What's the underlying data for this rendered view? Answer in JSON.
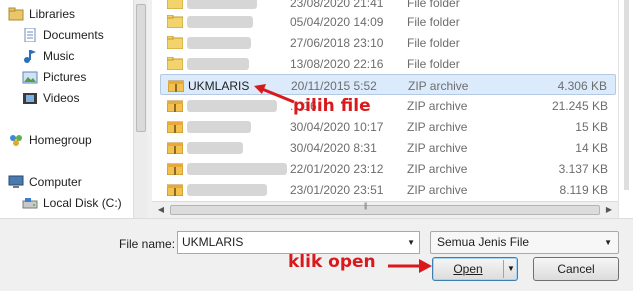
{
  "nav": {
    "items": [
      {
        "label": "Libraries",
        "icon": "libraries-icon"
      },
      {
        "label": "Documents",
        "icon": "documents-icon"
      },
      {
        "label": "Music",
        "icon": "music-icon"
      },
      {
        "label": "Pictures",
        "icon": "pictures-icon"
      },
      {
        "label": "Videos",
        "icon": "videos-icon"
      },
      {
        "label": "Homegroup",
        "icon": "homegroup-icon"
      },
      {
        "label": "Computer",
        "icon": "computer-icon"
      },
      {
        "label": "Local Disk (C:)",
        "icon": "local-disk-icon"
      }
    ]
  },
  "files": [
    {
      "name": "",
      "date": "23/08/2020 21:41",
      "type": "File folder",
      "size": "",
      "kind": "folder"
    },
    {
      "name": "",
      "date": "05/04/2020 14:09",
      "type": "File folder",
      "size": "",
      "kind": "folder"
    },
    {
      "name": "",
      "date": "27/06/2018 23:10",
      "type": "File folder",
      "size": "",
      "kind": "folder"
    },
    {
      "name": "",
      "date": "13/08/2020 22:16",
      "type": "File folder",
      "size": "",
      "kind": "folder"
    },
    {
      "name": "UKMLARIS",
      "date": "20/11/2015 5:52",
      "type": "ZIP archive",
      "size": "4.306 KB",
      "kind": "zip"
    },
    {
      "name": "",
      "date": "...:16",
      "type": "ZIP archive",
      "size": "21.245 KB",
      "kind": "zip"
    },
    {
      "name": "",
      "date": "30/04/2020 10:17",
      "type": "ZIP archive",
      "size": "15 KB",
      "kind": "zip"
    },
    {
      "name": "",
      "date": "30/04/2020 8:31",
      "type": "ZIP archive",
      "size": "14 KB",
      "kind": "zip"
    },
    {
      "name": "",
      "date": "22/01/2020 23:12",
      "type": "ZIP archive",
      "size": "3.137 KB",
      "kind": "zip"
    },
    {
      "name": "",
      "date": "23/01/2020 23:51",
      "type": "ZIP archive",
      "size": "8.119 KB",
      "kind": "zip"
    }
  ],
  "bottom": {
    "filename_label": "File name:",
    "filename_value": "UKMLARIS",
    "filetype_value": "Semua Jenis File",
    "open_label": "Open",
    "cancel_label": "Cancel"
  },
  "annotations": {
    "pick_file": "pilih file",
    "click_open": "klik open",
    "color": "#d9191c"
  },
  "colors": {
    "selection": "#dcebfc",
    "folder": "#f3d36b",
    "zip": "#f2c14e"
  }
}
